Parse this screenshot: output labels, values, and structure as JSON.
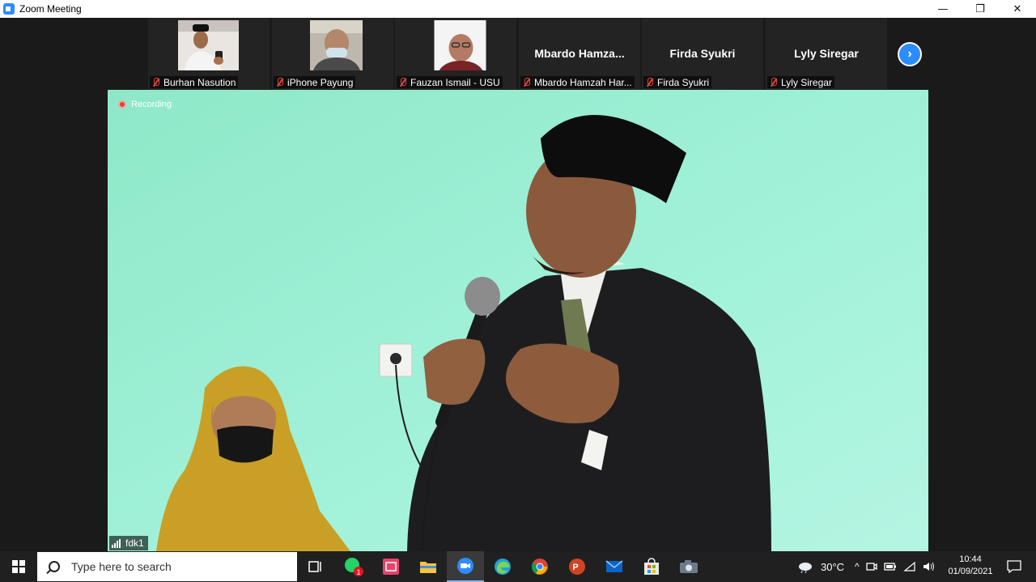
{
  "window": {
    "title": "Zoom Meeting",
    "controls": [
      "—",
      "❐",
      "✕"
    ]
  },
  "participants": [
    {
      "name": "Burhan Nasution",
      "display": "photo"
    },
    {
      "name": "iPhone Payung",
      "display": "photo"
    },
    {
      "name": "Fauzan Ismail - USU",
      "display": "photo"
    },
    {
      "name": "Mbardo Hamzah Har...",
      "display": "text",
      "big_name": "Mbardo  Hamza..."
    },
    {
      "name": "Firda Syukri",
      "display": "text",
      "big_name": "Firda Syukri"
    },
    {
      "name": "Lyly Siregar",
      "display": "text",
      "big_name": "Lyly Siregar"
    }
  ],
  "next_page_icon": "chevron-right-icon",
  "main": {
    "recording_label": "Recording",
    "speaker_name": "fdk1"
  },
  "taskbar": {
    "search_placeholder": "Type here to search",
    "apps": [
      "task-view-icon",
      "whatsapp-icon",
      "sticky-notes-icon",
      "file-explorer-icon",
      "zoom-icon",
      "edge-icon",
      "chrome-icon",
      "powerpoint-icon",
      "mail-icon",
      "store-icon",
      "camera-icon"
    ],
    "whatsapp_badge": "1",
    "weather": "30°C",
    "time": "10:44",
    "date": "01/09/2021"
  },
  "colors": {
    "accent": "#2d8cff",
    "wall": "#9ef0d6",
    "muted_mic": "#e0443c"
  }
}
